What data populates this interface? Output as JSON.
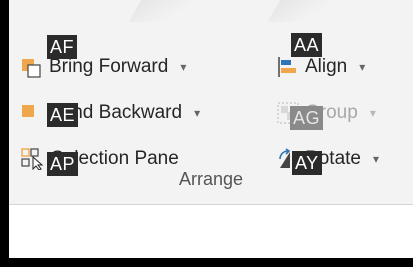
{
  "arrange": {
    "group_label": "Arrange",
    "bring_forward": {
      "label": "Bring Forward",
      "caret": "▾",
      "keytip": "AF",
      "icon": "bring-forward-icon"
    },
    "send_backward": {
      "label": "Send Backward",
      "caret": "▾",
      "keytip": "AE",
      "icon": "send-backward-icon"
    },
    "selection_pane": {
      "label": "Selection Pane",
      "keytip": "AP",
      "icon": "selection-pane-icon"
    },
    "align": {
      "label": "Align",
      "caret": "▾",
      "keytip": "AA",
      "icon": "align-icon"
    },
    "group": {
      "label": "Group",
      "caret": "▾",
      "keytip": "AG",
      "icon": "group-icon",
      "disabled": true
    },
    "rotate": {
      "label": "Rotate",
      "caret": "▾",
      "keytip": "AY",
      "icon": "rotate-icon"
    }
  },
  "colors": {
    "accent_orange": "#f0a64b",
    "accent_blue": "#2e75b6",
    "keytip_bg": "#2b2b2b",
    "ribbon_bg": "#f3f3f3"
  }
}
